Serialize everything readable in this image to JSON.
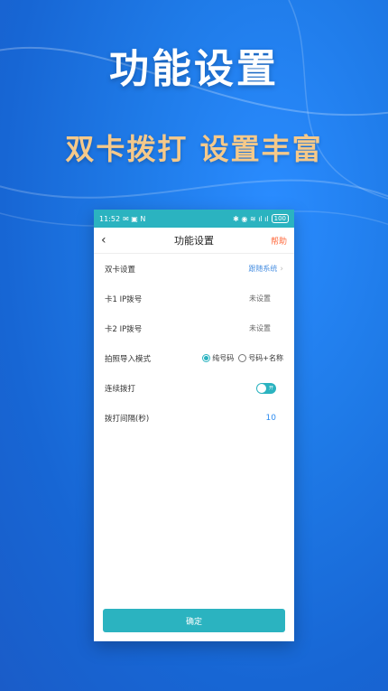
{
  "promo": {
    "headline": "功能设置",
    "subline": "双卡拨打 设置丰富"
  },
  "status_bar": {
    "time": "11:52",
    "left_icons": "✉ ▣ N",
    "right_icons": "✱ ◉ ≋ ıl ıl",
    "battery": "100"
  },
  "nav": {
    "back_icon": "‹",
    "title": "功能设置",
    "help_label": "帮助"
  },
  "settings": {
    "dual_card": {
      "label": "双卡设置",
      "value": "跟随系统",
      "chevron": "›"
    },
    "card1_ip": {
      "label": "卡1 IP拨号",
      "value": "未设置"
    },
    "card2_ip": {
      "label": "卡2 IP拨号",
      "value": "未设置"
    },
    "import_mode": {
      "label": "拍照导入模式",
      "options": [
        "纯号码",
        "号码+名称"
      ],
      "selected_index": 0
    },
    "continuous_dial": {
      "label": "连续拨打",
      "toggle_text": "开",
      "on": true
    },
    "dial_interval": {
      "label": "拨打间隔(秒)",
      "value": "10"
    }
  },
  "confirm_label": "确定",
  "colors": {
    "accent": "#2bb3c0",
    "help": "#ff6a3d",
    "headline": "#ffffff",
    "subline": "#f5c98a",
    "background": "#1f7be8"
  }
}
